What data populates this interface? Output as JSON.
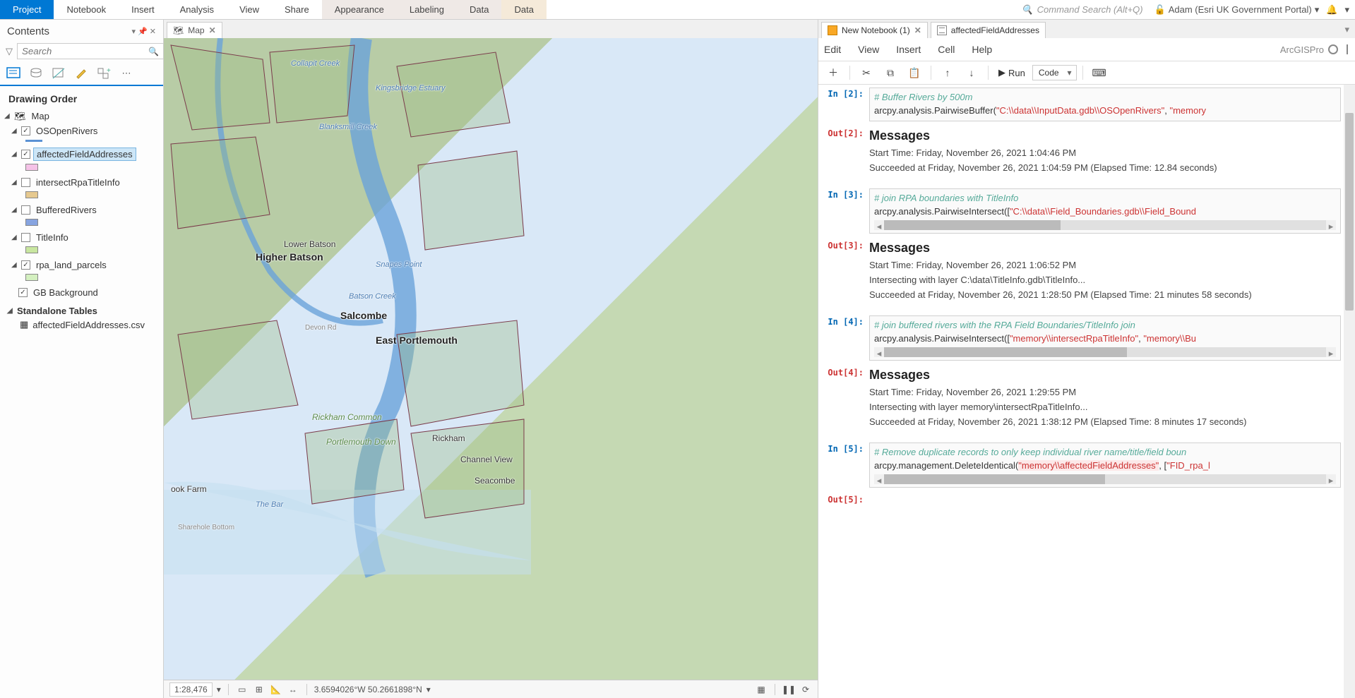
{
  "ribbon": {
    "tabs": [
      "Project",
      "Notebook",
      "Insert",
      "Analysis",
      "View",
      "Share",
      "Appearance",
      "Labeling",
      "Data",
      "Data"
    ],
    "search_placeholder": "Command Search (Alt+Q)",
    "user": "Adam (Esri UK Government Portal)"
  },
  "contents": {
    "title": "Contents",
    "search_placeholder": "Search",
    "section": "Drawing Order",
    "map_label": "Map",
    "layers": [
      {
        "name": "OSOpenRivers",
        "checked": true,
        "swatch": "sw-river"
      },
      {
        "name": "affectedFieldAddresses",
        "checked": true,
        "swatch": "sw-pink",
        "selected": true
      },
      {
        "name": "intersectRpaTitleInfo",
        "checked": false,
        "swatch": "sw-tan"
      },
      {
        "name": "BufferedRivers",
        "checked": false,
        "swatch": "sw-blue"
      },
      {
        "name": "TitleInfo",
        "checked": false,
        "swatch": "sw-green"
      },
      {
        "name": "rpa_land_parcels",
        "checked": true,
        "swatch": "sw-lgreen"
      }
    ],
    "gb_background": {
      "name": "GB Background",
      "checked": true
    },
    "standalone_title": "Standalone Tables",
    "standalone_table": "affectedFieldAddresses.csv"
  },
  "map": {
    "tab": "Map",
    "scale": "1:28,476",
    "coords": "3.6594026°W 50.2661898°N",
    "places": {
      "p1": "Collapit Creek",
      "p2": "Kingsbridge Estuary",
      "p3": "Blanksmill Creek",
      "p4": "Lower Batson",
      "p5": "Higher Batson",
      "p6": "Snapes Point",
      "p7": "Batson Creek",
      "p8": "Salcombe",
      "p9": "Devon Rd",
      "p10": "East Portlemouth",
      "p11": "Rickham Common",
      "p12": "Portlemouth Down",
      "p13": "Rickham",
      "p14": "Channel View",
      "p15": "Seacombe",
      "p16": "ook Farm",
      "p17": "The Bar",
      "p18": "Sharehole Bottom"
    }
  },
  "notebook": {
    "tab1": "New Notebook (1)",
    "tab2": "affectedFieldAddresses",
    "menu": [
      "Edit",
      "View",
      "Insert",
      "Cell",
      "Help"
    ],
    "brand": "ArcGISPro",
    "run_label": "Run",
    "select_value": "Code",
    "cells": {
      "in2_prompt": "In [2]:",
      "in2_comment": "# Buffer Rivers by 500m",
      "in2_code_a": "arcpy.analysis.PairwiseBuffer(",
      "in2_str1": "\"C:\\\\data\\\\InputData.gdb\\\\OSOpenRivers\"",
      "in2_mid": ", ",
      "in2_str2": "\"memory",
      "out2_prompt": "Out[2]:",
      "out2_title": "Messages",
      "out2_l1": "Start Time: Friday, November 26, 2021 1:04:46 PM",
      "out2_l2": "Succeeded at Friday, November 26, 2021 1:04:59 PM (Elapsed Time: 12.84 seconds)",
      "in3_prompt": "In [3]:",
      "in3_comment": "# join RPA boundaries with TitleInfo",
      "in3_code_a": "arcpy.analysis.PairwiseIntersect([",
      "in3_str1": "\"C:\\\\data\\\\Field_Boundaries.gdb\\\\Field_Bound",
      "out3_prompt": "Out[3]:",
      "out3_title": "Messages",
      "out3_l1": "Start Time: Friday, November 26, 2021 1:06:52 PM",
      "out3_l2": "Intersecting with layer C:\\data\\TitleInfo.gdb\\TitleInfo...",
      "out3_l3": "Succeeded at Friday, November 26, 2021 1:28:50 PM (Elapsed Time: 21 minutes 58 seconds)",
      "in4_prompt": "In [4]:",
      "in4_comment": "# join buffered rivers with the RPA Field Boundaries/TitleInfo join",
      "in4_code_a": "arcpy.analysis.PairwiseIntersect([",
      "in4_str1": "\"memory\\\\intersectRpaTitleInfo\"",
      "in4_mid": ", ",
      "in4_str2": "\"memory\\\\Bu",
      "out4_prompt": "Out[4]:",
      "out4_title": "Messages",
      "out4_l1": "Start Time: Friday, November 26, 2021 1:29:55 PM",
      "out4_l2": "Intersecting with layer memory\\intersectRpaTitleInfo...",
      "out4_l3": "Succeeded at Friday, November 26, 2021 1:38:12 PM (Elapsed Time: 8 minutes 17 seconds)",
      "in5_prompt": "In [5]:",
      "in5_comment": "# Remove duplicate records to only keep individual river name/title/field boun",
      "in5_code_a": "arcpy.management.DeleteIdentical(",
      "in5_str1": "\"memory\\\\affectedFieldAddresses\"",
      "in5_mid": ", [",
      "in5_str2": "\"FID_rpa_l",
      "out5_prompt": "Out[5]:"
    }
  }
}
